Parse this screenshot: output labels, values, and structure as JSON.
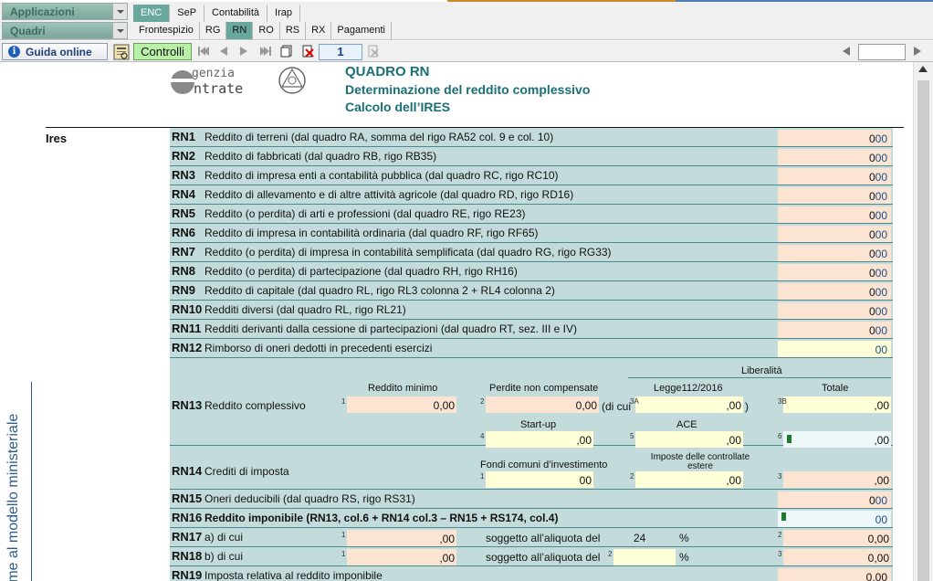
{
  "header": {
    "applicazioni": "Applicazioni",
    "quadri": "Quadri",
    "tabs_top": [
      "ENC",
      "SeP",
      "Contabilità",
      "Irap"
    ],
    "tabs_sub": [
      "Frontespizio",
      "RG",
      "RN",
      "RO",
      "RS",
      "RX",
      "Pagamenti"
    ],
    "active_top": "ENC",
    "active_sub": "RN"
  },
  "toolbar": {
    "guida": "Guida online",
    "controlli": "Controlli",
    "page": "1"
  },
  "colors": {
    "accent": "#6aa89e",
    "form_bg": "#c3dcdb",
    "field_bg": "#fce4d3",
    "field_yellow": "#ffffd8",
    "title": "#1a6f74"
  },
  "doc": {
    "side_label": "rme al modello ministeriale",
    "logo_top": "genzia",
    "logo_bottom": "ntrate",
    "title": "QUADRO RN",
    "subtitle1": "Determinazione del reddito complessivo",
    "subtitle2": "Calcolo dell’IRES",
    "section": "Ires"
  },
  "rows": [
    {
      "code": "RN1",
      "desc": "Reddito di terreni (dal quadro RA, somma del rigo RA52 col. 9 e col. 10)",
      "int": "0",
      "dec": "00"
    },
    {
      "code": "RN2",
      "desc": "Reddito di fabbricati (dal quadro RB, rigo RB35)",
      "int": "0",
      "dec": "00"
    },
    {
      "code": "RN3",
      "desc": "Reddito di impresa enti a contabilità pubblica (dal quadro RC, rigo RC10)",
      "int": "0",
      "dec": "00"
    },
    {
      "code": "RN4",
      "desc": "Reddito di allevamento e di altre attività agricole (dal quadro RD, rigo RD16)",
      "int": "0",
      "dec": "00"
    },
    {
      "code": "RN5",
      "desc": "Reddito (o perdita) di arti e professioni (dal quadro RE, rigo RE23)",
      "int": "0",
      "dec": "00"
    },
    {
      "code": "RN6",
      "desc": "Reddito di impresa in contabilità ordinaria (dal quadro RF, rigo RF65)",
      "int": "0",
      "dec": "00"
    },
    {
      "code": "RN7",
      "desc": "Reddito (o perdita) di impresa in contabilità semplificata (dal quadro RG, rigo RG33)",
      "int": "0",
      "dec": "00"
    },
    {
      "code": "RN8",
      "desc": "Reddito (o perdita) di partecipazione (dal quadro RH, rigo RH16)",
      "int": "0",
      "dec": "00"
    },
    {
      "code": "RN9",
      "desc": "Reddito di capitale (dal quadro RL, rigo RL3 colonna 2 + RL4 colonna 2)",
      "int": "0",
      "dec": "00"
    },
    {
      "code": "RN10",
      "desc": "Redditi diversi (dal quadro RL, rigo RL21)",
      "int": "0",
      "dec": "00"
    },
    {
      "code": "RN11",
      "desc": "Redditi derivanti dalla cessione di partecipazioni (dal quadro RT, sez. III e IV)",
      "int": "0",
      "dec": "00"
    },
    {
      "code": "RN12",
      "desc": "Rimborso di oneri dedotti in precedenti esercizi",
      "int": "",
      "dec": "00"
    }
  ],
  "rn13": {
    "code": "RN13",
    "desc": "Reddito complessivo",
    "liberalita": "Liberalità",
    "reddito_minimo": "Reddito minimo",
    "perdite": "Perdite non compensate",
    "legge": "Legge112/2016",
    "totale": "Totale",
    "dicui": "(di cui",
    "paren_close": ")",
    "val1": "0,00",
    "val2": "0,00",
    "val3a": ",00",
    "val3b": ",00",
    "startup": "Start-up",
    "ace": "ACE",
    "val4": ",00",
    "val5": ",00",
    "val6": ",00"
  },
  "rn14": {
    "code": "RN14",
    "desc": "Crediti di imposta",
    "fondi": "Fondi comuni d’investimento",
    "imposte": "Imposte delle controllate estere",
    "val1": "00",
    "val2": ",00",
    "val3": ",00"
  },
  "rn15": {
    "code": "RN15",
    "desc": "Oneri deducibili (dal quadro RS, rigo RS31)",
    "int": "0",
    "dec": "00"
  },
  "rn16": {
    "code": "RN16",
    "desc": "Reddito imponibile (RN13, col.6 + RN14 col.3 – RN15 + RS174, col.4)",
    "dec": "00"
  },
  "rn17": {
    "code": "RN17",
    "desc": "a) di cui",
    "soggetto": "soggetto all’aliquota del",
    "aliquota": "24",
    "pct": "%",
    "val1": ",00",
    "val2": "0,00"
  },
  "rn18": {
    "code": "RN18",
    "desc": "b) di cui",
    "soggetto": "soggetto all’aliquota del",
    "pct": "%",
    "val1": ",00",
    "val2": "0,00"
  },
  "rn19": {
    "code": "RN19",
    "desc": "Imposta relativa al reddito imponibile",
    "val": "0,00"
  }
}
